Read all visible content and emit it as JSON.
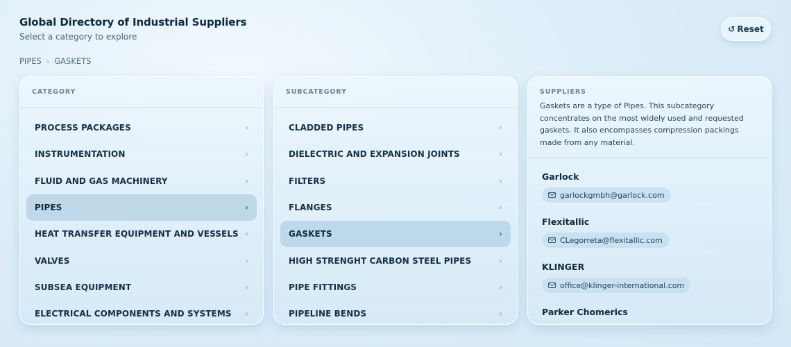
{
  "header": {
    "title": "Global Directory of Industrial Suppliers",
    "subtitle": "Select a category to explore",
    "reset_label": "Reset",
    "reset_icon": "↺"
  },
  "breadcrumb": [
    "PIPES",
    "GASKETS"
  ],
  "breadcrumb_separator": "›",
  "category": {
    "header": "CATEGORY",
    "items": [
      {
        "label": "PROCESS PACKAGES"
      },
      {
        "label": "INSTRUMENTATION"
      },
      {
        "label": "FLUID AND GAS MACHINERY"
      },
      {
        "label": "PIPES",
        "selected": true
      },
      {
        "label": "HEAT TRANSFER EQUIPMENT AND VESSELS"
      },
      {
        "label": "VALVES"
      },
      {
        "label": "SUBSEA EQUIPMENT"
      },
      {
        "label": "ELECTRICAL COMPONENTS AND SYSTEMS"
      }
    ]
  },
  "subcategory": {
    "header": "SUBCATEGORY",
    "items": [
      {
        "label": "CLADDED PIPES"
      },
      {
        "label": "DIELECTRIC AND EXPANSION JOINTS"
      },
      {
        "label": "FILTERS"
      },
      {
        "label": "FLANGES"
      },
      {
        "label": "GASKETS",
        "selected": true
      },
      {
        "label": "HIGH STRENGHT CARBON STEEL PIPES"
      },
      {
        "label": "PIPE FITTINGS"
      },
      {
        "label": "PIPELINE BENDS"
      }
    ]
  },
  "suppliers": {
    "header": "SUPPLIERS",
    "description": "Gaskets are a type of Pipes. This subcategory concentrates on the most widely used and requested gaskets. It also encompasses compression packings made from any material.",
    "items": [
      {
        "name": "Garlock",
        "email": "garlockgmbh@garlock.com"
      },
      {
        "name": "Flexitallic",
        "email": "CLegorreta@flexitallic.com"
      },
      {
        "name": "KLINGER",
        "email": "office@klinger-international.com"
      },
      {
        "name": "Parker Chomerics",
        "email": ""
      }
    ]
  },
  "icons": {
    "chevron": "›",
    "mail": "mail-icon"
  },
  "colors": {
    "accent_selected": "#b2d0e4",
    "text_dark": "#0f2a3d"
  }
}
